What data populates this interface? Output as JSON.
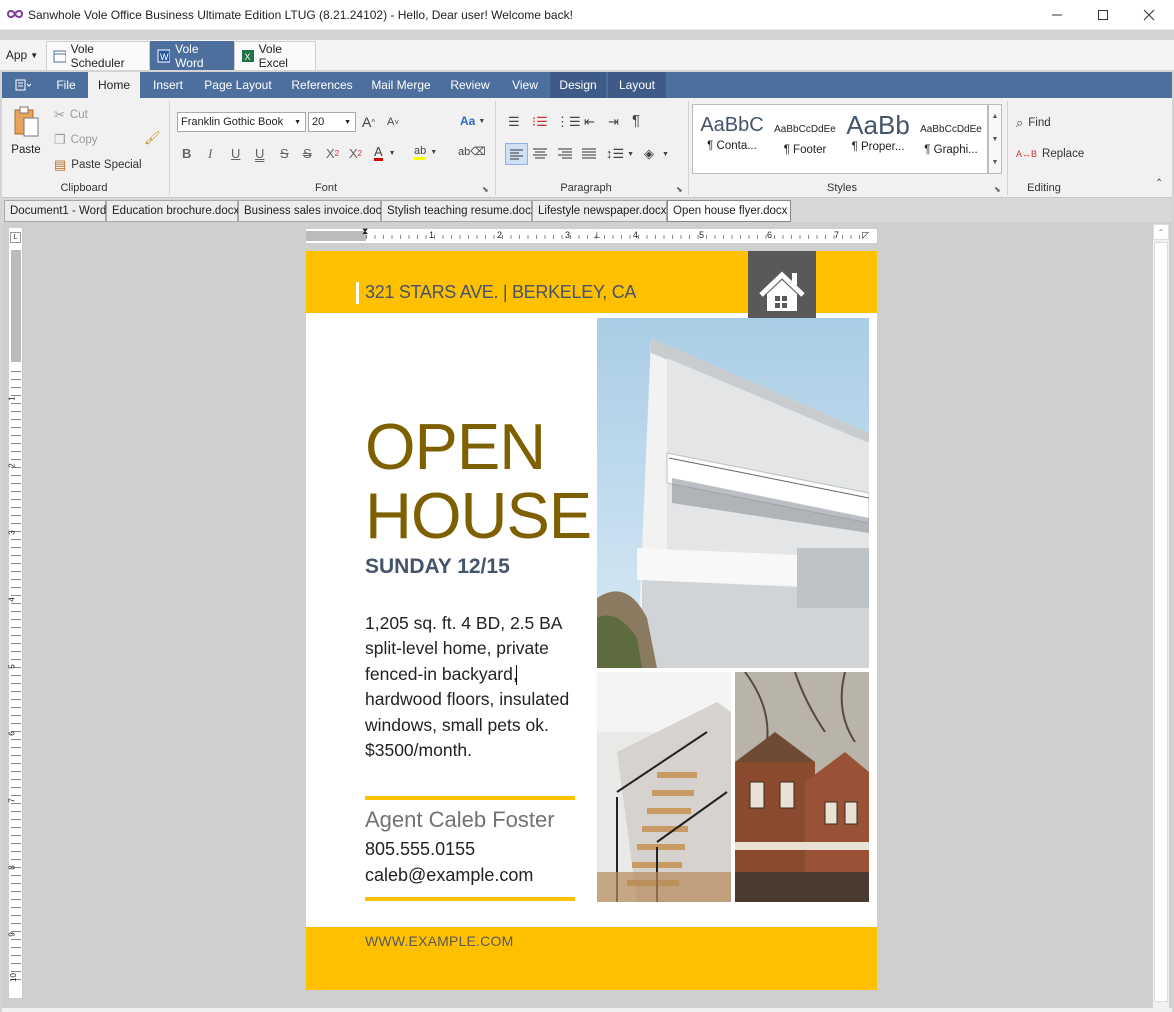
{
  "window": {
    "title": "Sanwhole Vole Office  Business Ultimate Edition LTUG (8.21.24102) - Hello, Dear user! Welcome back!"
  },
  "app_menu": {
    "label": "App"
  },
  "app_tabs": [
    "Vole Scheduler",
    "Vole Word",
    "Vole Excel"
  ],
  "ribbon_tabs": [
    "File",
    "Home",
    "Insert",
    "Page Layout",
    "References",
    "Mail Merge",
    "Review",
    "View",
    "Design",
    "Layout"
  ],
  "clipboard": {
    "paste": "Paste",
    "cut": "Cut",
    "copy": "Copy",
    "paste_special": "Paste Special",
    "group": "Clipboard"
  },
  "font": {
    "name": "Franklin Gothic Book",
    "size": "20",
    "grow": "A",
    "shrink": "A",
    "case": "Aa",
    "bold": "B",
    "italic": "I",
    "underline": "U",
    "double_underline": "U",
    "strike": "S",
    "double_strike": "S",
    "superscript": "X",
    "sup_mark": "2",
    "subscript": "X",
    "sub_mark": "2",
    "color": "A",
    "group": "Font"
  },
  "paragraph": {
    "group": "Paragraph"
  },
  "styles": {
    "items": [
      {
        "sample": "AaBbC",
        "name": "¶ Conta..."
      },
      {
        "sample": "AaBbCcDdEe",
        "name": "¶ Footer"
      },
      {
        "sample": "AaBb",
        "name": "¶ Proper..."
      },
      {
        "sample": "AaBbCcDdEe",
        "name": "¶ Graphi..."
      }
    ],
    "group": "Styles"
  },
  "editing": {
    "find": "Find",
    "replace": "Replace",
    "group": "Editing"
  },
  "doc_tabs": [
    "Document1 - Word",
    "Education brochure.docx",
    "Business sales invoice.docx",
    "Stylish teaching resume.docx",
    "Lifestyle newspaper.docx",
    "Open house flyer.docx"
  ],
  "ruler": {
    "h_numbers": [
      "1",
      "2",
      "3",
      "4",
      "5",
      "6",
      "7"
    ],
    "v_numbers": [
      "1",
      "2",
      "3",
      "4",
      "5",
      "6",
      "7",
      "8",
      "9",
      "10"
    ]
  },
  "flyer": {
    "address": "321 STARS AVE. | BERKELEY, CA",
    "title_line1": "OPEN",
    "title_line2": "HOUSE",
    "date": "SUNDAY 12/15",
    "description_lines": [
      "1,205 sq. ft. 4 BD, 2.5 BA",
      "split-level home, private",
      "fenced-in backyard,",
      "hardwood floors, insulated",
      "windows, small pets ok.",
      "$3500/month."
    ],
    "agent": "Agent Caleb Foster",
    "phone": "805.555.0155",
    "email": "caleb@example.com",
    "website": "WWW.EXAMPLE.COM",
    "colors": {
      "band": "#ffc000",
      "title": "#7f6000",
      "dark": "#44546a",
      "badge": "#595959"
    }
  }
}
